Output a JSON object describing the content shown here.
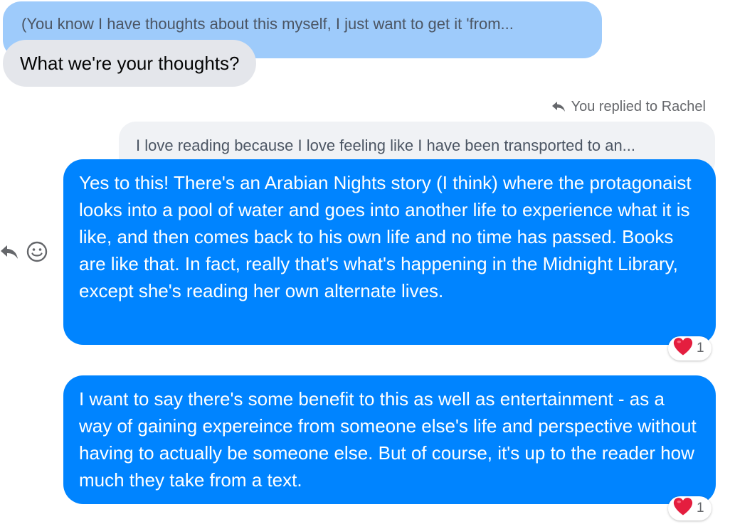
{
  "thread": {
    "quoted_incoming": "(You know I have thoughts about this myself, I just want to get it 'from...",
    "incoming_message": "What we're your thoughts?",
    "reply_indicator": "You replied to Rachel",
    "quoted_outgoing": "I love reading because I love feeling like I have been transported to an...",
    "outgoing_messages": [
      {
        "text": "Yes to this! There's an Arabian Nights story (I think) where the protagonaist looks into a pool of water and goes into another life to experience what it is like, and then comes back to his own life and no time has passed. Books are like that. In fact, really that's what's happening in the Midnight Library, except she's reading her own alternate lives.",
        "reaction": {
          "icon": "heart-icon",
          "count": "1"
        }
      },
      {
        "text": "I want to say there's some benefit to this as well as entertainment - as a way of gaining expereince from someone else's life and perspective without having to actually be someone else. But of course, it's up to the reader how much they take from a text.",
        "reaction": {
          "icon": "heart-icon",
          "count": "1"
        }
      }
    ],
    "side_actions": [
      {
        "icon": "reply-icon"
      },
      {
        "icon": "emoji-icon"
      }
    ]
  },
  "colors": {
    "outgoing_bubble": "#0084ff",
    "incoming_bubble": "#e4e6eb",
    "quoted_incoming_bubble": "#9ecbfb",
    "quoted_outgoing_bubble": "#f0f2f5",
    "heart": "#e41e3f"
  }
}
